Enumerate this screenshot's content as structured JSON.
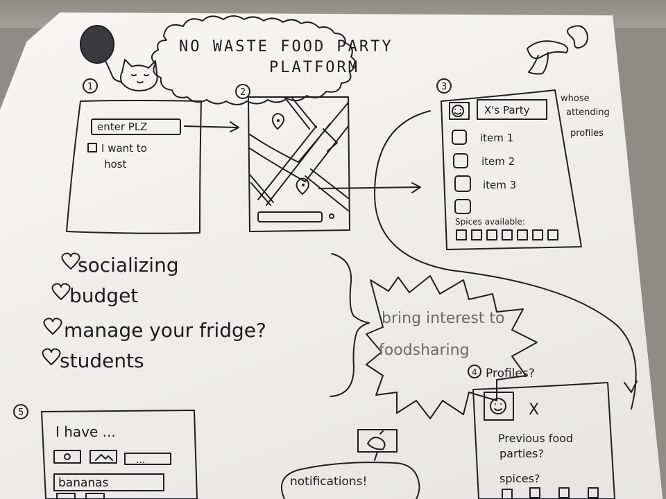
{
  "title": {
    "line1": "NO WASTE FOOD PARTY",
    "line2": "PLATFORM"
  },
  "screens": {
    "s1": {
      "number": "1",
      "input_placeholder": "enter PLZ",
      "checkbox_label_line1": "I want to",
      "checkbox_label_line2": "host"
    },
    "s2": {
      "number": "2"
    },
    "s3": {
      "number": "3",
      "party_title": "X's Party",
      "side_note_1": "whose",
      "side_note_2": "attending",
      "side_note_3": "profiles",
      "items": [
        "item 1",
        "item 2",
        "item 3"
      ],
      "spices_label": "Spices available:"
    },
    "s4": {
      "number": "4",
      "heading": "Profiles?",
      "name": "X",
      "note_line1": "Previous food",
      "note_line2": "parties?",
      "note_line3": "spices?"
    },
    "s5": {
      "number": "5",
      "label": "I have ...",
      "ellipsis": "...",
      "input_value": "bananas"
    }
  },
  "benefits": [
    "socializing",
    "budget",
    "manage your fridge?",
    "students"
  ],
  "callout": {
    "line1": "bring interest to",
    "line2": "foodsharing"
  },
  "notification": {
    "label": "notifications!"
  }
}
